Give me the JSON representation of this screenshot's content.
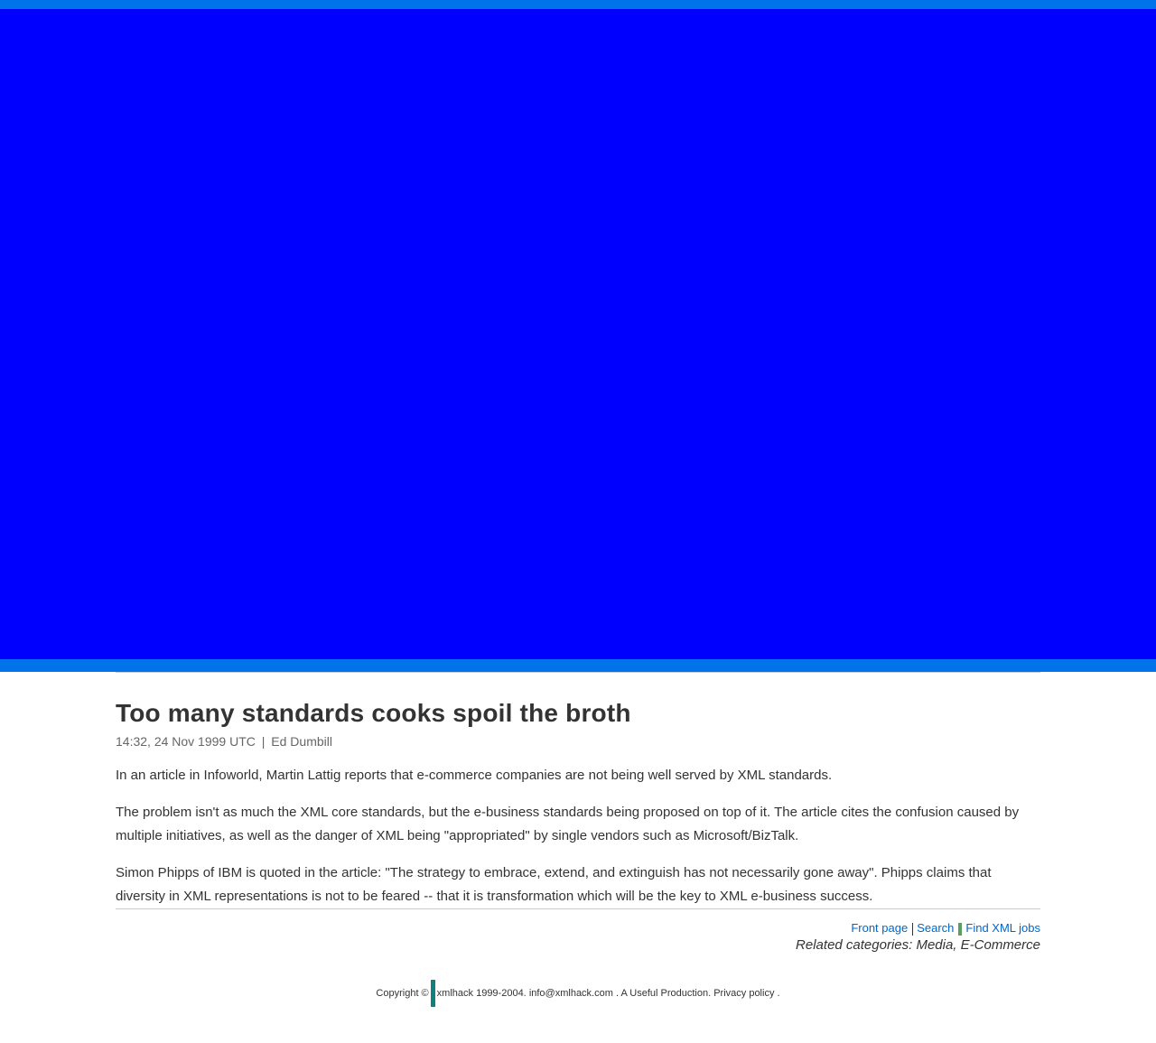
{
  "colors": {
    "banner": "#0000ff",
    "strip": "#0073ea",
    "link": "#0066cc",
    "text": "#333333",
    "muted": "#666666"
  },
  "article": {
    "title": "Too many standards cooks spoil the broth",
    "byline": {
      "time": "14:32, 24 Nov 1999 UTC",
      "separator": "|",
      "author": "Ed Dumbill"
    },
    "paragraphs": [
      "In an article in Infoworld, Martin Lattig reports that e-commerce companies are not being well served by XML standards.",
      "The problem isn't as much the XML core standards, but the e-business standards being proposed on top of it. The article cites the confusion caused by multiple initiatives, as well as the danger of XML being \"appropriated\" by single vendors such as Microsoft/BizTalk.",
      "Simon Phipps of IBM is quoted in the article: \"The strategy to embrace, extend, and extinguish has not necessarily gone away\". Phipps claims that diversity in XML representations is not to be feared -- that it is transformation which will be the key to XML e-business success."
    ]
  },
  "nav": {
    "front_page": "Front page",
    "search": "Search",
    "find_jobs": "Find XML jobs"
  },
  "related": "Related categories: Media, E-Commerce",
  "footer": {
    "copyright": "Copyright ©",
    "site": "xmlhack",
    "years": "1999-2004.",
    "email": "info@xmlhack.com",
    "production": ". A Useful Production.",
    "privacy": "Privacy policy",
    "end": "."
  }
}
